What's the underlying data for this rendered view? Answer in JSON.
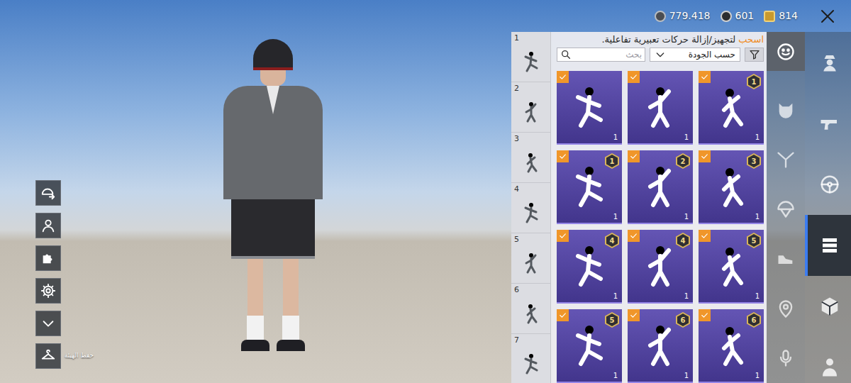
{
  "currency": [
    {
      "kind": "bp",
      "amount": "779.418"
    },
    {
      "kind": "ag",
      "amount": "601"
    },
    {
      "kind": "uc",
      "amount": "814"
    }
  ],
  "tools": [
    {
      "kind": "helmet-swap"
    },
    {
      "kind": "portrait"
    },
    {
      "kind": "puzzle"
    },
    {
      "kind": "gear"
    },
    {
      "kind": "chevron"
    },
    {
      "kind": "hanger",
      "label": "حفظ الهيئة"
    }
  ],
  "panel": {
    "hint_highlight": "اسحب",
    "hint": "لتجهيز/إزالة حركات تعبيرية تفاعلية.",
    "sort": "حسب الجودة",
    "search_placeholder": "بحث"
  },
  "slots": [
    {
      "number": "1"
    },
    {
      "number": "2"
    },
    {
      "number": "3"
    },
    {
      "number": "4"
    },
    {
      "number": "5"
    },
    {
      "number": "6"
    },
    {
      "number": "7"
    }
  ],
  "emotes": [
    {
      "equipped": true,
      "badge": null,
      "count": "1"
    },
    {
      "equipped": true,
      "badge": null,
      "count": "1"
    },
    {
      "equipped": true,
      "badge": "1",
      "count": "1"
    },
    {
      "equipped": true,
      "badge": "1",
      "count": "1"
    },
    {
      "equipped": true,
      "badge": "2",
      "count": "1"
    },
    {
      "equipped": true,
      "badge": "3",
      "count": "1"
    },
    {
      "equipped": true,
      "badge": "4",
      "count": "1"
    },
    {
      "equipped": true,
      "badge": "4",
      "count": "1"
    },
    {
      "equipped": true,
      "badge": "5",
      "count": "1"
    },
    {
      "equipped": true,
      "badge": "5",
      "count": "1"
    },
    {
      "equipped": true,
      "badge": "6",
      "count": "1"
    },
    {
      "equipped": true,
      "badge": "6",
      "count": "1"
    }
  ],
  "categories": [
    {
      "kind": "emote",
      "selected": true
    },
    {
      "kind": "pet",
      "selected": false
    },
    {
      "kind": "glider",
      "selected": false
    },
    {
      "kind": "parachute",
      "selected": false
    },
    {
      "kind": "shoe",
      "selected": false
    },
    {
      "kind": "pin",
      "selected": false
    },
    {
      "kind": "mic",
      "selected": false
    }
  ],
  "sections": [
    {
      "kind": "agent",
      "selected": false
    },
    {
      "kind": "gun",
      "selected": false
    },
    {
      "kind": "wheel",
      "selected": false
    },
    {
      "kind": "emblem",
      "selected": true
    },
    {
      "kind": "crate",
      "selected": false
    },
    {
      "kind": "person",
      "selected": false
    }
  ]
}
